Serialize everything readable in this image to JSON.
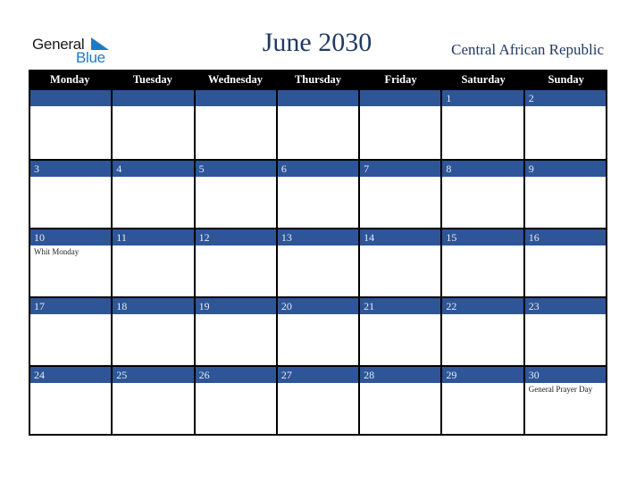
{
  "logo": {
    "line1": "General",
    "line2": "Blue"
  },
  "header": {
    "title": "June 2030",
    "country": "Central African Republic"
  },
  "colors": {
    "band": "#2e5597",
    "header_bg": "#000000",
    "title": "#213a63",
    "logo_blue": "#1f7ac4"
  },
  "weekdays": [
    "Monday",
    "Tuesday",
    "Wednesday",
    "Thursday",
    "Friday",
    "Saturday",
    "Sunday"
  ],
  "weeks": [
    [
      {
        "day": ""
      },
      {
        "day": ""
      },
      {
        "day": ""
      },
      {
        "day": ""
      },
      {
        "day": ""
      },
      {
        "day": "1"
      },
      {
        "day": "2"
      }
    ],
    [
      {
        "day": "3"
      },
      {
        "day": "4"
      },
      {
        "day": "5"
      },
      {
        "day": "6"
      },
      {
        "day": "7"
      },
      {
        "day": "8"
      },
      {
        "day": "9"
      }
    ],
    [
      {
        "day": "10",
        "event": "Whit Monday"
      },
      {
        "day": "11"
      },
      {
        "day": "12"
      },
      {
        "day": "13"
      },
      {
        "day": "14"
      },
      {
        "day": "15"
      },
      {
        "day": "16"
      }
    ],
    [
      {
        "day": "17"
      },
      {
        "day": "18"
      },
      {
        "day": "19"
      },
      {
        "day": "20"
      },
      {
        "day": "21"
      },
      {
        "day": "22"
      },
      {
        "day": "23"
      }
    ],
    [
      {
        "day": "24"
      },
      {
        "day": "25"
      },
      {
        "day": "26"
      },
      {
        "day": "27"
      },
      {
        "day": "28"
      },
      {
        "day": "29"
      },
      {
        "day": "30",
        "event": "General Prayer Day"
      }
    ]
  ]
}
